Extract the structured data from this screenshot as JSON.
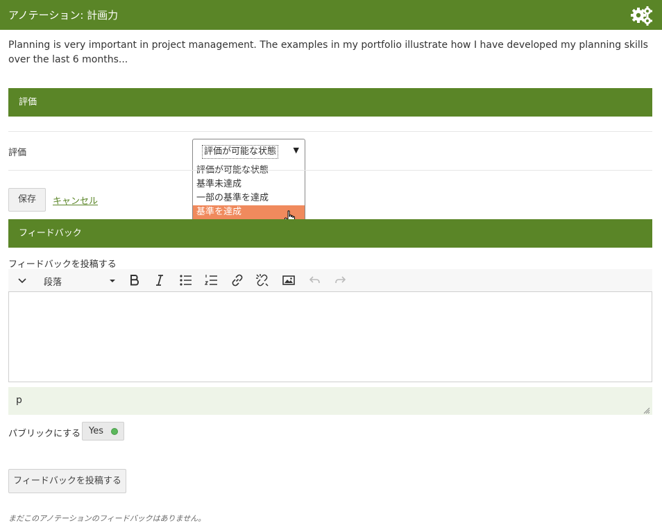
{
  "header": {
    "title": "アノテーション: 計画力",
    "settings_icon": "gears-icon",
    "accent_color": "#5a8527"
  },
  "annotation": {
    "text": "Planning is very important in project management. The examples in my portfolio illustrate how I have developed my planning skills over the last 6 months..."
  },
  "assessment": {
    "section_title": "評価",
    "field_label": "評価",
    "selected": "評価が可能な状態",
    "options": [
      "評価が可能な状態",
      "基準未達成",
      "一部の基準を達成",
      "基準を達成"
    ],
    "highlighted_option": "基準を達成",
    "highlight_color": "#f08a5d",
    "save_label": "保存",
    "cancel_label": "キャンセル"
  },
  "feedback": {
    "section_title": "フィードバック",
    "post_label": "フィードバックを投稿する",
    "toolbar": {
      "collapse_icon": "chevron-down-icon",
      "format_value": "段落",
      "buttons": [
        "bold-icon",
        "italic-icon",
        "bullet-list-icon",
        "numbered-list-icon",
        "link-icon",
        "unlink-icon",
        "image-icon",
        "undo-icon",
        "redo-icon"
      ]
    },
    "editor_path": "p",
    "public_label": "パブリックにする",
    "public_value": "Yes",
    "toggle_color": "#5cb85c",
    "submit_label": "フィードバックを投稿する",
    "empty_note": "まだこのアノテーションのフィードバックはありません。"
  }
}
